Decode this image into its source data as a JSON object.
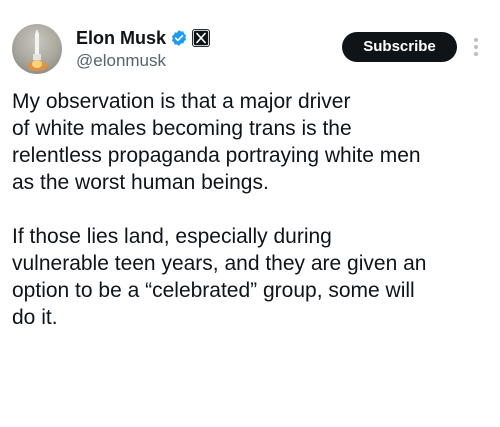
{
  "author": {
    "display_name": "Elon Musk",
    "handle": "@elonmusk",
    "avatar_icon": "rocket-launch-avatar",
    "verified_icon": "verified-badge-icon",
    "affiliation_icon": "x-logo-icon"
  },
  "actions": {
    "subscribe_label": "Subscribe",
    "more_icon": "more-vertical-icon"
  },
  "tweet": {
    "paragraph_1": "My observation is that a major driver\nof white males becoming trans is the\nrelentless propaganda portraying white men\nas the worst human beings.",
    "paragraph_2": "If those lies land, especially during\nvulnerable teen years, and they are given an\noption to be a “celebrated” group, some will\ndo it."
  },
  "colors": {
    "text_primary": "#0f1419",
    "text_secondary": "#536471",
    "verified_blue": "#1d9bf0",
    "button_bg": "#0f1419"
  }
}
